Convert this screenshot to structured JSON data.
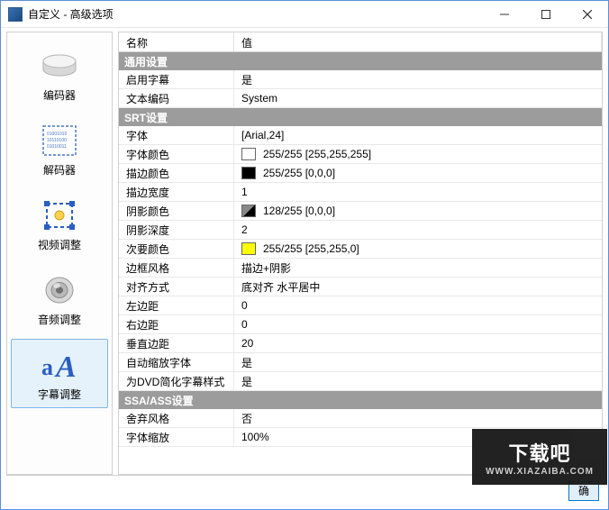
{
  "window": {
    "title": "自定义 - 高级选项"
  },
  "sidebar": {
    "items": [
      {
        "id": "encoder",
        "label": "编码器"
      },
      {
        "id": "decoder",
        "label": "解码器"
      },
      {
        "id": "video",
        "label": "视频调整"
      },
      {
        "id": "audio",
        "label": "音频调整"
      },
      {
        "id": "subtitle",
        "label": "字幕调整",
        "selected": true
      }
    ]
  },
  "grid": {
    "headers": {
      "name": "名称",
      "value": "值"
    },
    "sections": [
      {
        "title": "通用设置",
        "rows": [
          {
            "name": "启用字幕",
            "value": "是"
          },
          {
            "name": "文本编码",
            "value": "System"
          }
        ]
      },
      {
        "title": "SRT设置",
        "rows": [
          {
            "name": "字体",
            "value": "[Arial,24]"
          },
          {
            "name": "字体颜色",
            "value": "255/255 [255,255,255]",
            "swatch": "#ffffff"
          },
          {
            "name": "描边颜色",
            "value": "255/255 [0,0,0]",
            "swatch": "#000000"
          },
          {
            "name": "描边宽度",
            "value": "1"
          },
          {
            "name": "阴影颜色",
            "value": "128/255 [0,0,0]",
            "swatch": "diag"
          },
          {
            "name": "阴影深度",
            "value": "2"
          },
          {
            "name": "次要颜色",
            "value": "255/255 [255,255,0]",
            "swatch": "#ffff00"
          },
          {
            "name": "边框风格",
            "value": "描边+阴影"
          },
          {
            "name": "对齐方式",
            "value": "底对齐 水平居中"
          },
          {
            "name": "左边距",
            "value": "0"
          },
          {
            "name": "右边距",
            "value": "0"
          },
          {
            "name": "垂直边距",
            "value": "20"
          },
          {
            "name": "自动缩放字体",
            "value": "是"
          },
          {
            "name": "为DVD简化字幕样式",
            "value": "是"
          }
        ]
      },
      {
        "title": "SSA/ASS设置",
        "rows": [
          {
            "name": "舍弃风格",
            "value": "否"
          },
          {
            "name": "字体缩放",
            "value": "100%"
          }
        ]
      }
    ]
  },
  "footer": {
    "ok": "确"
  },
  "watermark": {
    "big": "下载吧",
    "small": "WWW.XIAZAIBA.COM"
  }
}
